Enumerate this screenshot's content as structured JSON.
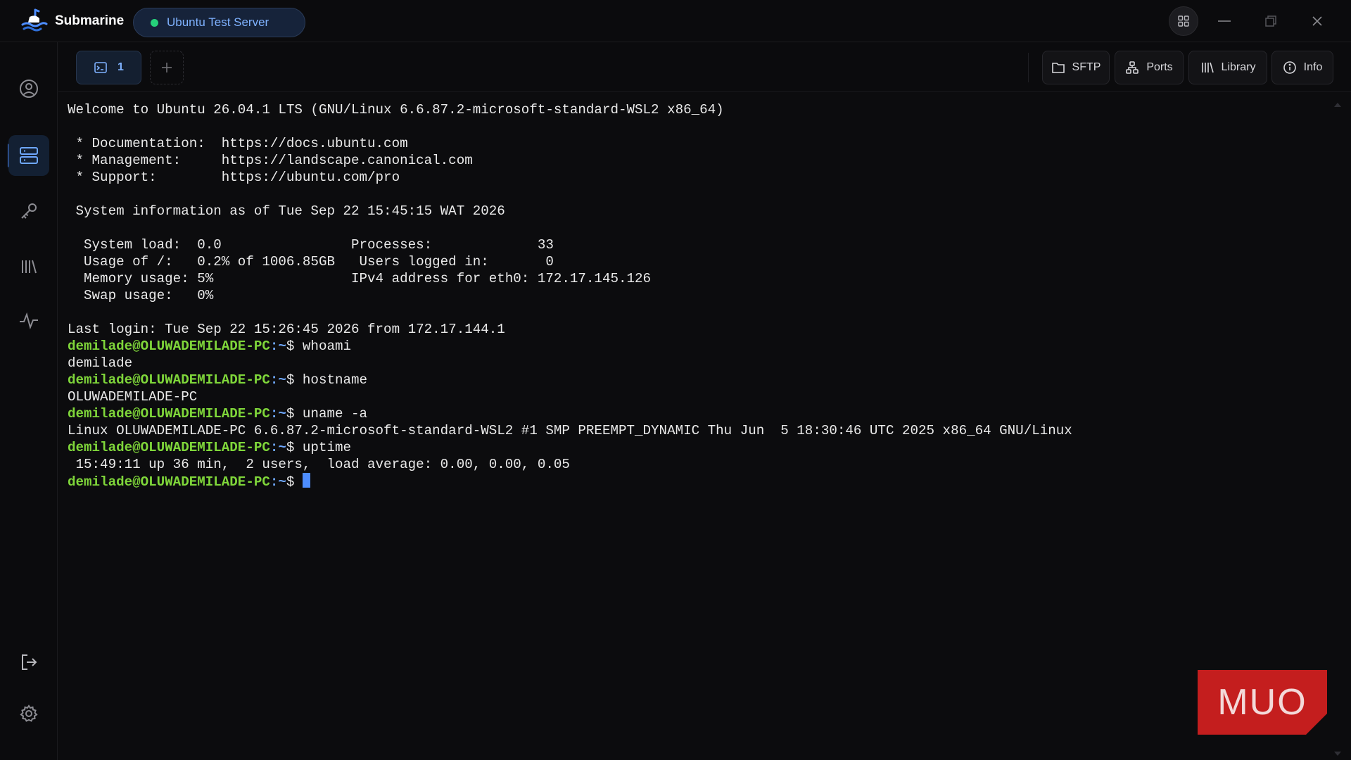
{
  "app": {
    "name": "Submarine"
  },
  "server": {
    "name": "Ubuntu Test Server",
    "status": "connected"
  },
  "window_controls": [
    "apps-grid-icon",
    "minimize-icon",
    "maximize-icon",
    "close-icon"
  ],
  "sidebar": {
    "items": [
      {
        "name": "profile",
        "icon": "user-circle-icon"
      },
      {
        "name": "hosts",
        "icon": "server-icon",
        "active": true
      },
      {
        "name": "keys",
        "icon": "key-icon"
      },
      {
        "name": "library",
        "icon": "library-icon"
      },
      {
        "name": "activity",
        "icon": "activity-icon"
      }
    ],
    "bottom": [
      {
        "name": "logout",
        "icon": "logout-icon"
      },
      {
        "name": "settings",
        "icon": "gear-icon"
      }
    ]
  },
  "tabs": [
    {
      "label": "1",
      "icon": "terminal-icon",
      "active": true
    }
  ],
  "toolbar": {
    "sftp": "SFTP",
    "ports": "Ports",
    "library": "Library",
    "info": "Info"
  },
  "terminal": {
    "lines": [
      "Welcome to Ubuntu 26.04.1 LTS (GNU/Linux 6.6.87.2-microsoft-standard-WSL2 x86_64)",
      "",
      " * Documentation:  https://docs.ubuntu.com",
      " * Management:     https://landscape.canonical.com",
      " * Support:        https://ubuntu.com/pro",
      "",
      " System information as of Tue Sep 22 15:45:15 WAT 2026",
      "",
      "  System load:  0.0                Processes:             33",
      "  Usage of /:   0.2% of 1006.85GB   Users logged in:       0",
      "  Memory usage: 5%                 IPv4 address for eth0: 172.17.145.126",
      "  Swap usage:   0%",
      "",
      "Last login: Tue Sep 22 15:26:45 2026 from 172.17.144.1"
    ],
    "prompt_user": "demilade@OLUWADEMILADE-PC",
    "prompt_path": ":~",
    "prompt_symbol": "$ ",
    "session": [
      {
        "command": "whoami",
        "output": "demilade"
      },
      {
        "command": "hostname",
        "output": "OLUWADEMILADE-PC"
      },
      {
        "command": "uname -a",
        "output": "Linux OLUWADEMILADE-PC 6.6.87.2-microsoft-standard-WSL2 #1 SMP PREEMPT_DYNAMIC Thu Jun  5 18:30:46 UTC 2025 x86_64 GNU/Linux"
      },
      {
        "command": "uptime",
        "output": " 15:49:11 up 36 min,  2 users,  load average: 0.00, 0.00, 0.05"
      }
    ]
  },
  "watermark": {
    "text": "MUO",
    "color": "#c41e1e"
  },
  "colors": {
    "accent": "#4d8dff",
    "prompt_user": "#7fd63a",
    "status_ok": "#25d07a",
    "background": "#0c0c0e"
  }
}
